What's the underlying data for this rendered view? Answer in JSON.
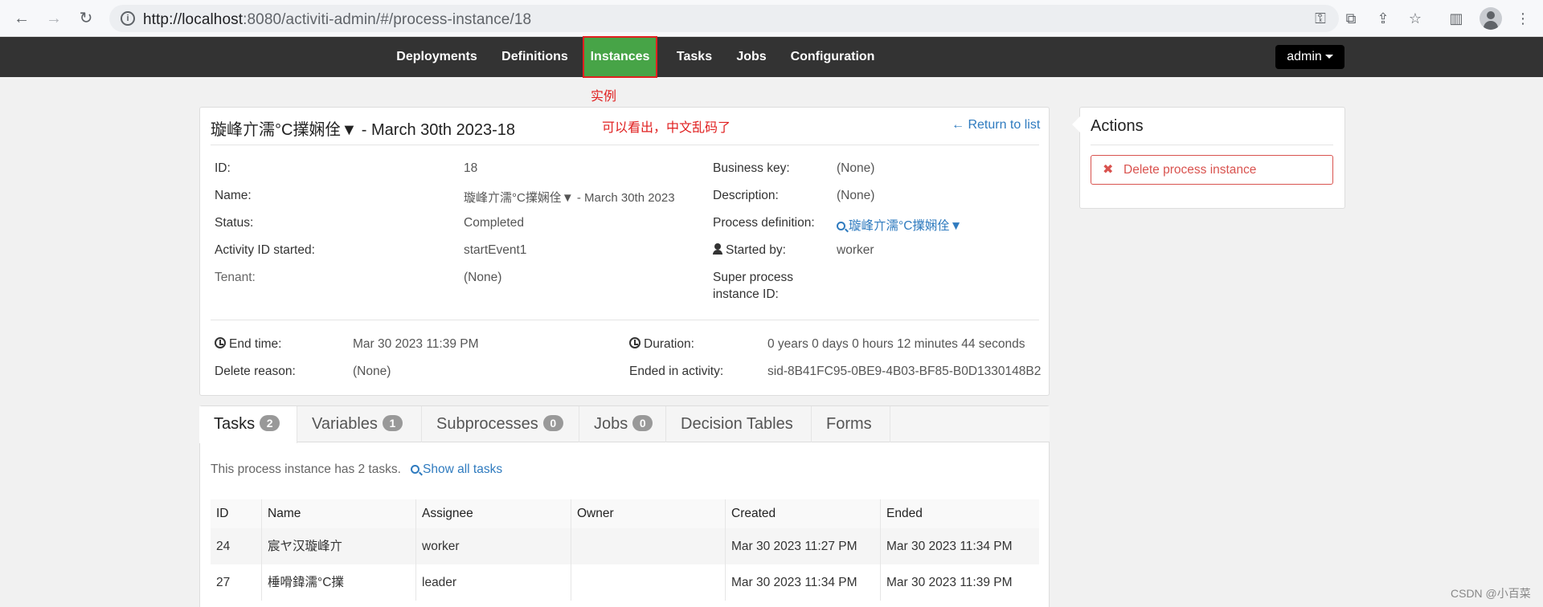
{
  "browser": {
    "url_host": "http://localhost",
    "url_path": ":8080/activiti-admin/#/process-instance/18"
  },
  "navbar": {
    "items": [
      "Deployments",
      "Definitions",
      "Instances",
      "Tasks",
      "Jobs",
      "Configuration"
    ],
    "active": "Instances",
    "user": "admin"
  },
  "annotations": {
    "instances_note": "实例",
    "garbled_note": "可以看出，中文乱码了"
  },
  "instance": {
    "title": "璇峰亣濡°C擈娴佺▼ - March 30th 2023-18",
    "return_link": "← Return to list",
    "fields": {
      "id_label": "ID:",
      "id_value": "18",
      "name_label": "Name:",
      "name_value": "璇峰亣濡°C擈娴佺▼ - March 30th 2023",
      "status_label": "Status:",
      "status_value": "Completed",
      "activity_label": "Activity ID started:",
      "activity_value": "startEvent1",
      "tenant_label": "Tenant:",
      "tenant_value": "(None)",
      "business_key_label": "Business key:",
      "business_key_value": "(None)",
      "description_label": "Description:",
      "description_value": "(None)",
      "process_def_label": "Process definition:",
      "process_def_value": "璇峰亣濡°C擈娴佺▼",
      "started_by_label": "Started by:",
      "started_by_value": "worker",
      "super_label_1": "Super process",
      "super_label_2": "instance ID:",
      "end_time_label": "End time:",
      "end_time_value": "Mar 30 2023 11:39 PM",
      "delete_reason_label": "Delete reason:",
      "delete_reason_value": "(None)",
      "duration_label": "Duration:",
      "duration_value": "0 years 0 days 0 hours 12 minutes 44 seconds",
      "ended_in_label": "Ended in activity:",
      "ended_in_value": "sid-8B41FC95-0BE9-4B03-BF85-B0D1330148B2"
    }
  },
  "actions": {
    "title": "Actions",
    "delete_button": "Delete process instance"
  },
  "tabs": [
    {
      "label": "Tasks",
      "count": "2"
    },
    {
      "label": "Variables",
      "count": "1"
    },
    {
      "label": "Subprocesses",
      "count": "0"
    },
    {
      "label": "Jobs",
      "count": "0"
    },
    {
      "label": "Decision Tables",
      "count": ""
    },
    {
      "label": "Forms",
      "count": ""
    }
  ],
  "tasks": {
    "summary": "This process instance has 2 tasks.",
    "show_all": "Show all tasks",
    "columns": [
      "ID",
      "Name",
      "Assignee",
      "Owner",
      "Created",
      "Ended"
    ],
    "rows": [
      [
        "24",
        "宸ヤ汉璇峰亣",
        "worker",
        "",
        "Mar 30 2023 11:27 PM",
        "Mar 30 2023 11:34 PM"
      ],
      [
        "27",
        "棰嗗鍏濡°C擈",
        "leader",
        "",
        "Mar 30 2023 11:34 PM",
        "Mar 30 2023 11:39 PM"
      ]
    ]
  },
  "watermark": "CSDN @小百菜"
}
